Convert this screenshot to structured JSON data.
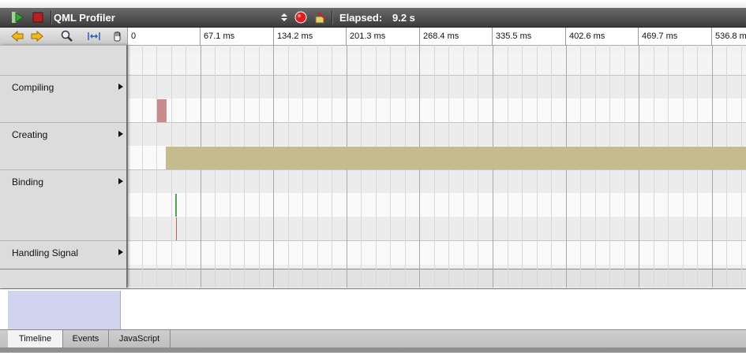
{
  "header": {
    "title": "QML Profiler",
    "elapsed_label": "Elapsed:",
    "elapsed_value": "9.2 s"
  },
  "ruler": {
    "ticks": [
      "0",
      "67.1 ms",
      "134.2 ms",
      "201.3 ms",
      "268.4 ms",
      "335.5 ms",
      "402.6 ms",
      "469.7 ms",
      "536.8 ms"
    ]
  },
  "categories": [
    {
      "label": "Compiling"
    },
    {
      "label": "Creating"
    },
    {
      "label": "Binding"
    },
    {
      "label": "Handling Signal"
    }
  ],
  "tabs": [
    {
      "label": "Timeline",
      "active": true
    },
    {
      "label": "Events",
      "active": false
    },
    {
      "label": "JavaScript",
      "active": false
    }
  ],
  "colors": {
    "compiling_event": "#c98c8c",
    "creating_event": "#c4bb8f",
    "binding_event": "#5aa05a",
    "signal_event": "#c06060",
    "overview_selection": "#d1d4ee"
  },
  "icons": {
    "start": "play-icon",
    "stop": "stop-icon",
    "record": "record-icon",
    "clear": "clear-icon",
    "prev": "arrow-left-icon",
    "next": "arrow-right-icon",
    "zoom": "zoom-icon",
    "range": "range-select-icon",
    "drag": "hand-icon"
  }
}
